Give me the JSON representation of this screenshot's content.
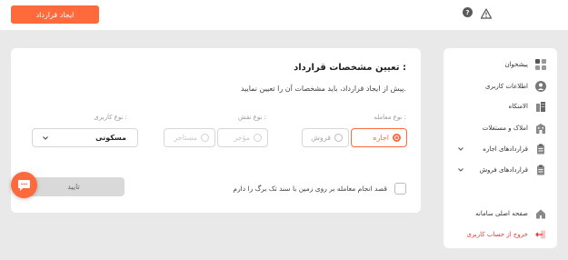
{
  "header": {
    "create_contract_label": "ایجاد قرارداد",
    "help_symbol": "?",
    "icons": [
      "help-icon",
      "warning-icon"
    ]
  },
  "sidebar": {
    "items": [
      {
        "label": "پیشخوان",
        "icon": "grid-icon"
      },
      {
        "label": "اطلاعات کاربری",
        "icon": "user-icon"
      },
      {
        "label": "الامنکاه",
        "icon": "buildings-icon"
      },
      {
        "label": "املاک و مستغلات",
        "icon": "building-icon"
      },
      {
        "label": "قراردادهای اجاره",
        "icon": "clipboard-icon",
        "expandable": true
      },
      {
        "label": "قراردادهای فروش",
        "icon": "clipboard-icon",
        "expandable": true
      },
      {
        "label": "صفحه اصلی سامانه",
        "icon": "home-icon"
      },
      {
        "label": "خروج از حساب کاربری",
        "icon": "logout-icon",
        "color": "#e53935"
      }
    ]
  },
  "main": {
    "title": "تعیین مشخصات قرارداد :",
    "subtitle": "پیش از ایجاد قرارداد، باید مشخصات آن را تعیین نمایید.",
    "deal_type": {
      "label": "نوع معامله :",
      "options": [
        "اجاره",
        "فروش"
      ],
      "selected": "اجاره"
    },
    "role_type": {
      "label": "نوع نقش :",
      "options": [
        "مؤجر",
        "مستاجر"
      ],
      "selected": null
    },
    "usage_type": {
      "label": "نوع کاربری :",
      "value": "مسکونی"
    },
    "checkbox_label": "قصد انجام معامله بر روی زمین با سند تک برگ را دارم",
    "checkbox_checked": false,
    "confirm_label": "تایید"
  },
  "colors": {
    "accent": "#ff6a3d",
    "background": "#e9e9ea",
    "danger": "#e53935"
  }
}
